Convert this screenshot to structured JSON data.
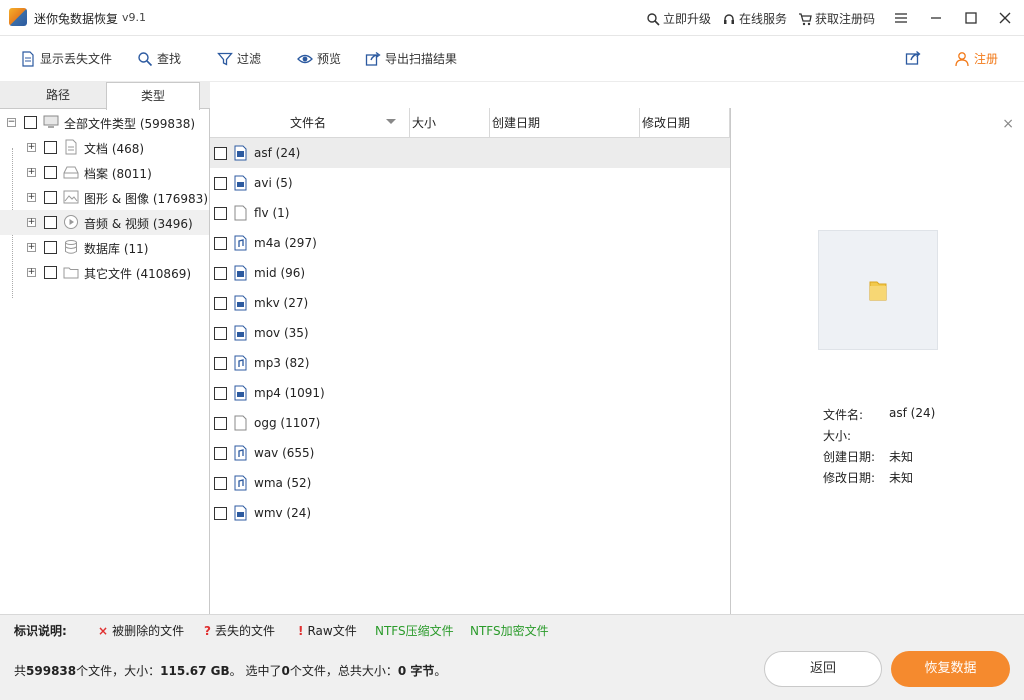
{
  "app": {
    "title": "迷你兔数据恢复",
    "version": "v9.1",
    "upgrade_label": "立即升级",
    "service_label": "在线服务",
    "register_code_label": "获取注册码"
  },
  "toolbar": {
    "show_lost_label": "显示丢失文件",
    "find_label": "查找",
    "filter_label": "过滤",
    "preview_label": "预览",
    "export_label": "导出扫描结果",
    "register_label": "注册"
  },
  "tabs": {
    "path_label": "路径",
    "type_label": "类型"
  },
  "tree": {
    "root": {
      "label": "全部文件类型",
      "count": "(599838)"
    },
    "items": [
      {
        "label": "文档",
        "count": "(468)"
      },
      {
        "label": "档案",
        "count": "(8011)"
      },
      {
        "label": "图形 & 图像",
        "count": "(176983)"
      },
      {
        "label": "音频 & 视频",
        "count": "(3496)"
      },
      {
        "label": "数据库",
        "count": "(11)"
      },
      {
        "label": "其它文件",
        "count": "(410869)"
      }
    ]
  },
  "columns": {
    "name": "文件名",
    "size": "大小",
    "created": "创建日期",
    "modified": "修改日期"
  },
  "files": [
    {
      "label": "asf (24)"
    },
    {
      "label": "avi (5)"
    },
    {
      "label": "flv (1)"
    },
    {
      "label": "m4a (297)"
    },
    {
      "label": "mid (96)"
    },
    {
      "label": "mkv (27)"
    },
    {
      "label": "mov (35)"
    },
    {
      "label": "mp3 (82)"
    },
    {
      "label": "mp4 (1091)"
    },
    {
      "label": "ogg (1107)"
    },
    {
      "label": "wav (655)"
    },
    {
      "label": "wma (52)"
    },
    {
      "label": "wmv (24)"
    }
  ],
  "preview": {
    "close_glyph": "×",
    "name_label": "文件名:",
    "name_value": "asf (24)",
    "size_label": "大小:",
    "size_value": "",
    "created_label": "创建日期:",
    "created_value": "未知",
    "modified_label": "修改日期:",
    "modified_value": "未知"
  },
  "legend": {
    "title": "标识说明:",
    "deleted_mark": "×",
    "deleted_label": "被删除的文件",
    "lost_mark": "?",
    "lost_label": "丢失的文件",
    "raw_mark": "!",
    "raw_label": "Raw文件",
    "ntfs_compressed": "NTFS压缩文件",
    "ntfs_encrypted": "NTFS加密文件"
  },
  "status": {
    "prefix": "共",
    "total_files": "599838",
    "files_suffix": "个文件，大小：",
    "total_size": "115.67 GB",
    "selected_prefix": "。 选中了",
    "selected_count": "0",
    "selected_suffix": "个文件，总共大小：",
    "selected_size": "0 字节",
    "end": "。"
  },
  "buttons": {
    "back_label": "返回",
    "recover_label": "恢复数据"
  },
  "colors": {
    "accent_orange": "#f58a2e",
    "deleted_red": "#e03030",
    "ntfs_green": "#2b9b2b"
  }
}
